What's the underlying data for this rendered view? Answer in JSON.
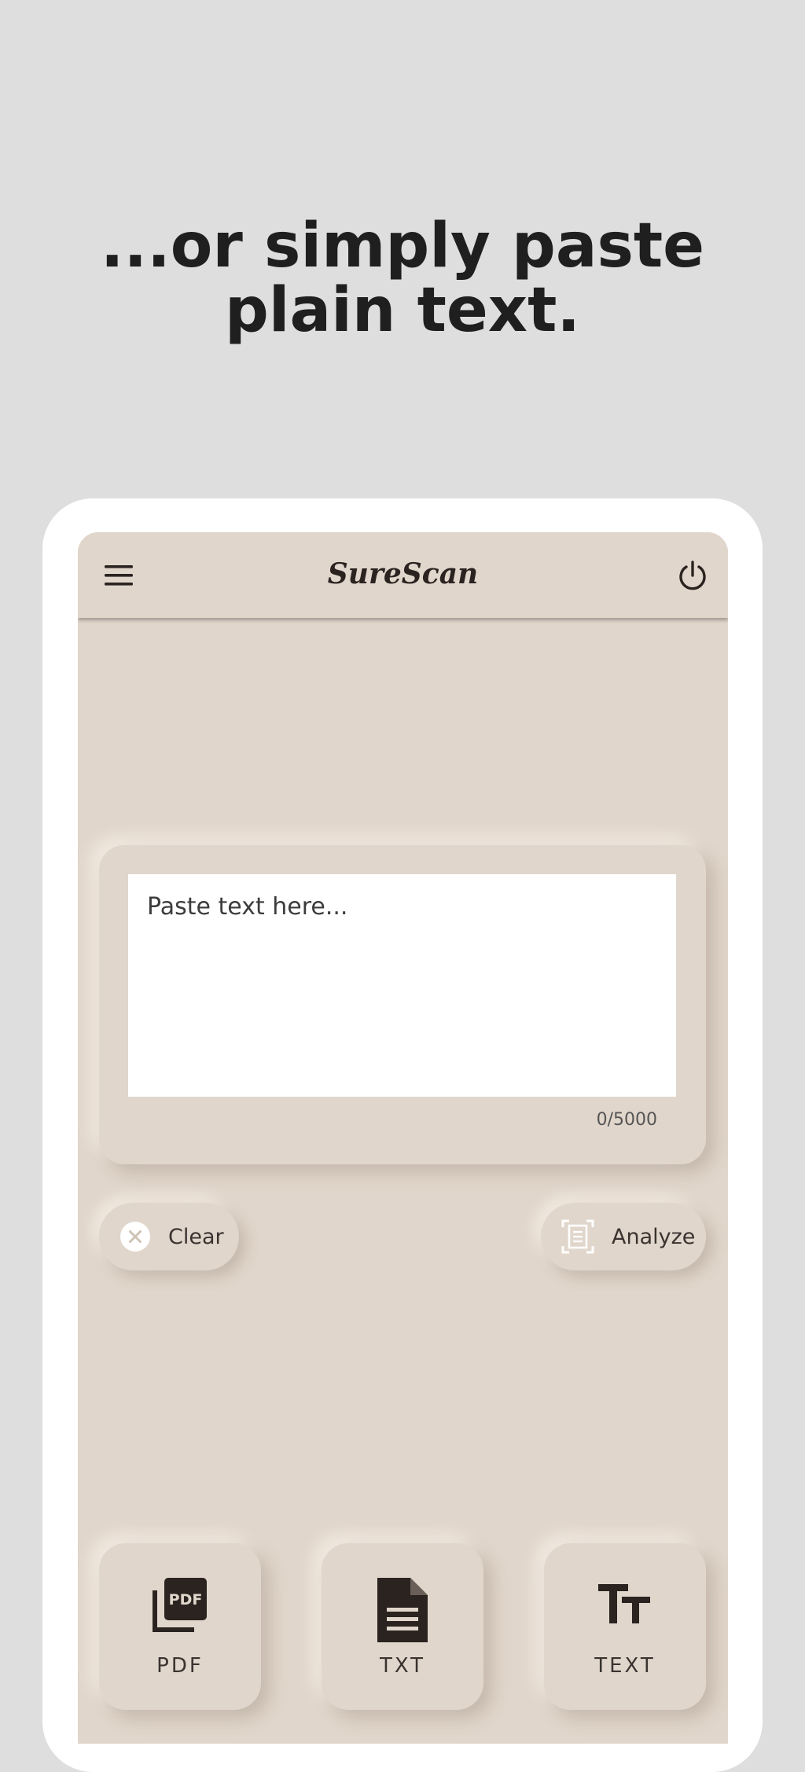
{
  "promo": {
    "headline_line1": "...or simply paste",
    "headline_line2": "plain text."
  },
  "appbar": {
    "title": "SureScan",
    "menu_icon": "hamburger-menu-icon",
    "power_icon": "power-icon"
  },
  "input": {
    "placeholder": "Paste text here...",
    "value": "",
    "char_count": "0/5000"
  },
  "actions": {
    "clear_label": "Clear",
    "clear_icon": "close-circle-icon",
    "analyze_label": "Analyze",
    "analyze_icon": "document-scan-icon"
  },
  "source_tiles": [
    {
      "label": "PDF",
      "icon": "pdf-file-icon"
    },
    {
      "label": "TXT",
      "icon": "text-document-icon"
    },
    {
      "label": "TEXT",
      "icon": "text-size-icon"
    }
  ],
  "colors": {
    "background": "#dedede",
    "screen": "#e1d6cb",
    "frame": "#ffffff",
    "text_dark": "#1f1f1f"
  }
}
